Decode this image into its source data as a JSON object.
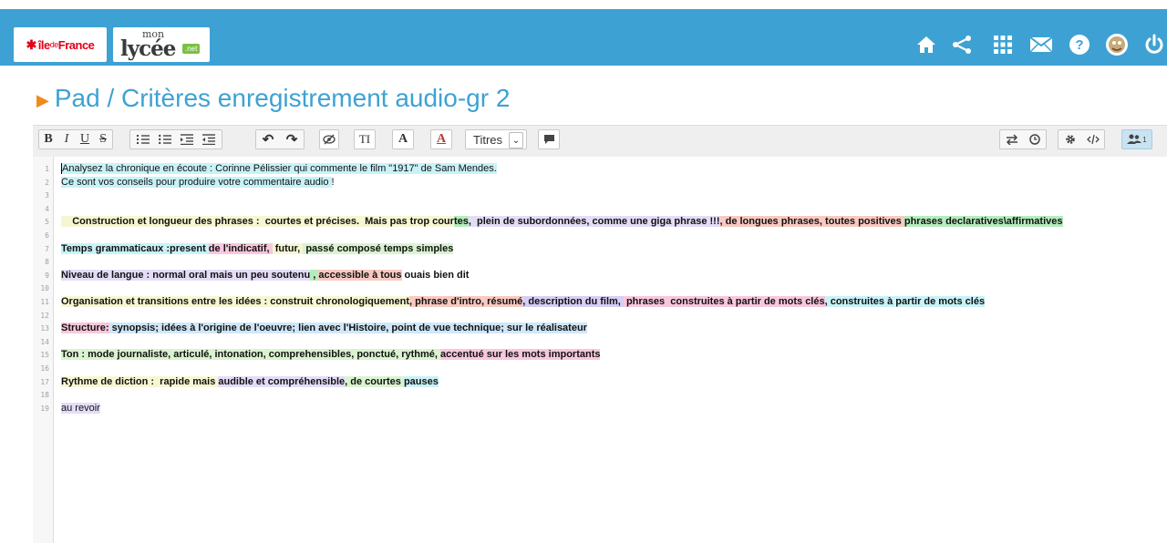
{
  "header": {
    "logo_idf": {
      "star": "✱",
      "ile": "île",
      "de": "de",
      "france": "France"
    },
    "logo_lycee": {
      "mon": "mon",
      "lycee": "lycée",
      "net": ".net"
    }
  },
  "header_icons": [
    "home-icon",
    "share-icon",
    "apps-grid-icon",
    "mail-icon",
    "help-icon",
    "user-avatar-icon",
    "power-icon"
  ],
  "page": {
    "title": "Pad / Critères enregistrement audio-gr 2"
  },
  "toolbar": {
    "bold": "B",
    "italic": "I",
    "underline": "U",
    "strike": "S",
    "undo": "↶",
    "redo": "↷",
    "text_size": "TI",
    "font_a": "A",
    "font_color_a": "A",
    "headings": "Titres",
    "headings_caret": "⌄",
    "users_count": "1"
  },
  "editor": {
    "lines": [
      {
        "n": "1",
        "segments": [
          {
            "text": "Analysez la chronique en écoute : Corinne Pélissier qui commente le film \"1917\" de Sam Mendes.",
            "hl": "cyan"
          }
        ]
      },
      {
        "n": "2",
        "segments": [
          {
            "text": "Ce sont vos conseils pour produire votre commentaire audio ",
            "hl": "cyan"
          },
          {
            "text": "!",
            "hl": ""
          }
        ]
      },
      {
        "n": "3",
        "segments": []
      },
      {
        "n": "4",
        "segments": []
      },
      {
        "n": "5",
        "bold": true,
        "segments": [
          {
            "text": "    Construction et longueur des phrases :  courtes et précises.  Mais pas trop cour",
            "hl": "yellow"
          },
          {
            "text": "tes",
            "hl": "green"
          },
          {
            "text": ",  plein de subordonnées, comme une giga phrase !!!",
            "hl": "lavender"
          },
          {
            "text": ", de longues phrases, toutes positives ",
            "hl": "peach"
          },
          {
            "text": "phrases declaratives\\affirmatives",
            "hl": "green"
          }
        ]
      },
      {
        "n": "6",
        "segments": []
      },
      {
        "n": "7",
        "bold": true,
        "segments": [
          {
            "text": "Temps grammaticaux :present ",
            "hl": "cyan"
          },
          {
            "text": "de l'indicatif, ",
            "hl": "pink"
          },
          {
            "text": " futur, ",
            "hl": "yellow"
          },
          {
            "text": " passé composé temps simples",
            "hl": "lime"
          }
        ]
      },
      {
        "n": "8",
        "segments": []
      },
      {
        "n": "9",
        "bold": true,
        "segments": [
          {
            "text": "Niveau de langue : normal oral mais un peu soutenu",
            "hl": "lavender"
          },
          {
            "text": " , ",
            "hl": "green"
          },
          {
            "text": "accessible à tous",
            "hl": "peach"
          },
          {
            "text": " ouais bien dit",
            "hl": ""
          }
        ]
      },
      {
        "n": "10",
        "segments": []
      },
      {
        "n": "11",
        "bold": true,
        "segments": [
          {
            "text": "Organisation et transitions entre les idées : construit chronologiquement",
            "hl": "yellow"
          },
          {
            "text": ", phrase d'intro, résumé",
            "hl": "peach"
          },
          {
            "text": ", description du film, ",
            "hl": "purple"
          },
          {
            "text": " phrases  construites à partir de mots clés",
            "hl": "pink"
          },
          {
            "text": ", construites à partir de mots clés",
            "hl": "cyan"
          }
        ]
      },
      {
        "n": "12",
        "segments": []
      },
      {
        "n": "13",
        "bold": true,
        "segments": [
          {
            "text": "Structure:",
            "hl": "pink"
          },
          {
            "text": " synopsis; idées à l'origine de l'oeuvre; lien avec l'Histoire, point de vue technique; sur le réalisateur",
            "hl": "lightblue"
          }
        ]
      },
      {
        "n": "14",
        "segments": []
      },
      {
        "n": "15",
        "bold": true,
        "segments": [
          {
            "text": "Ton : mode journaliste, articulé, intonation, comprehensibles, ponctué, rythmé, ",
            "hl": "lime"
          },
          {
            "text": "accentué sur les mots importants",
            "hl": "pink"
          }
        ]
      },
      {
        "n": "16",
        "segments": []
      },
      {
        "n": "17",
        "bold": true,
        "segments": [
          {
            "text": "Rythme de diction :  rapide mais ",
            "hl": "yellow"
          },
          {
            "text": "audible et compréhensible",
            "hl": "lavender"
          },
          {
            "text": ", de courtes ",
            "hl": "lime"
          },
          {
            "text": "pauses",
            "hl": "cyan"
          }
        ]
      },
      {
        "n": "18",
        "segments": []
      },
      {
        "n": "19",
        "segments": [
          {
            "text": "au revoir",
            "hl": "lavender"
          }
        ]
      }
    ]
  },
  "colors": {
    "header_bg": "#3da2d3",
    "title": "#3da2d3",
    "title_arrow": "#f08a1c"
  }
}
